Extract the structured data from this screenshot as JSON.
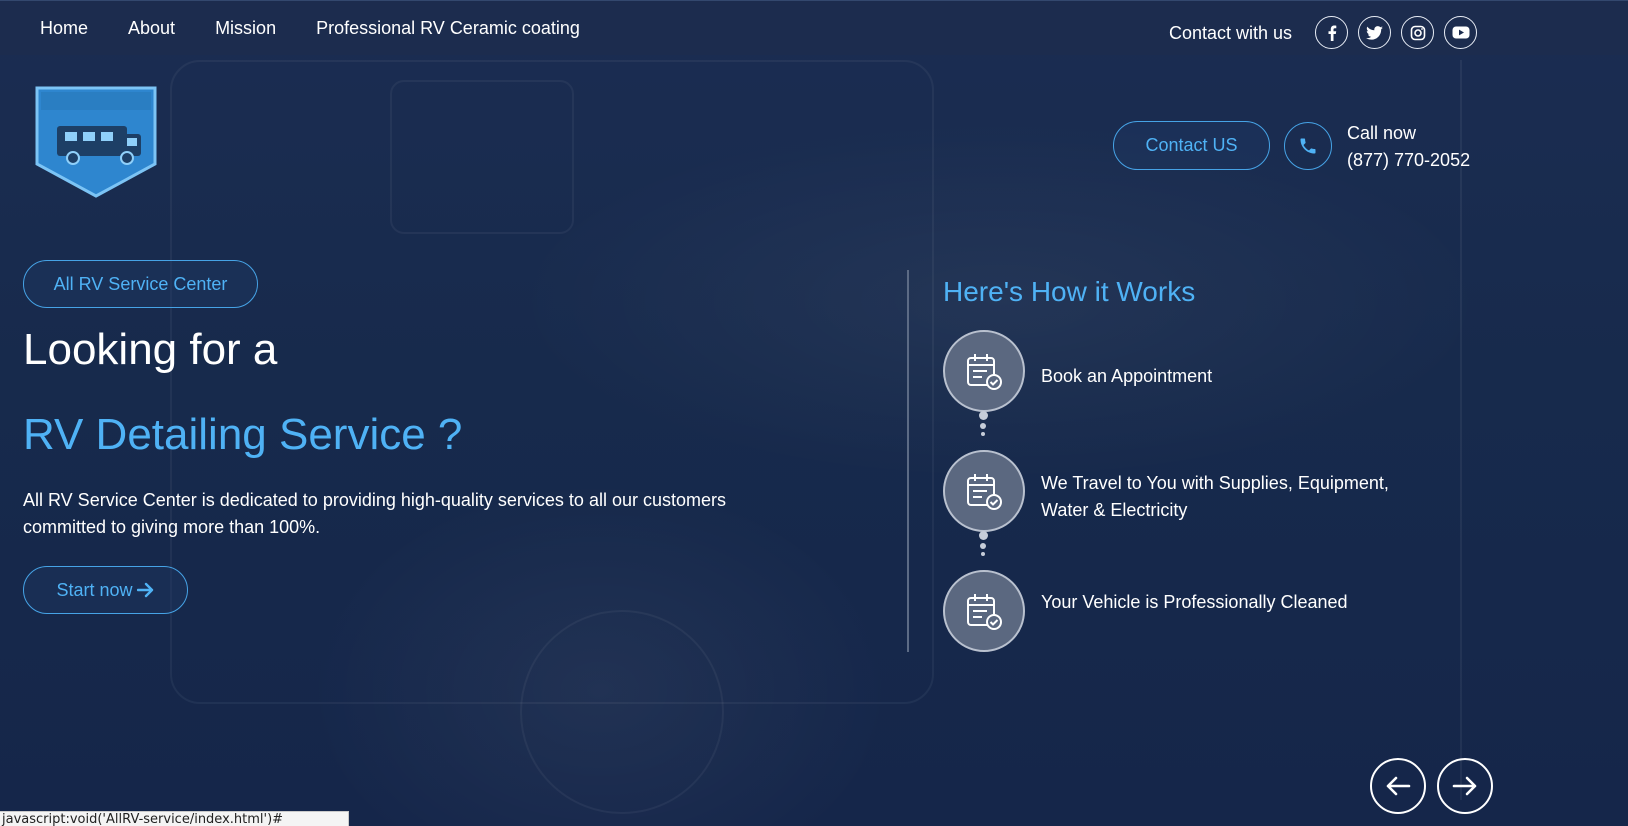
{
  "nav": {
    "items": [
      "Home",
      "About",
      "Mission",
      "Professional RV Ceramic coating"
    ]
  },
  "contact": {
    "label": "Contact with us",
    "socials": [
      "facebook-icon",
      "twitter-icon",
      "instagram-icon",
      "youtube-icon"
    ]
  },
  "logo": {
    "text": "ALL RV SERVICE CENTER"
  },
  "header_actions": {
    "contact_button": "Contact US",
    "call_label": "Call now",
    "phone": "(877) 770-2052"
  },
  "hero": {
    "tag": "All RV Service Center",
    "heading_line1": "Looking for a",
    "heading_line2": "RV Detailing Service ?",
    "description": "All RV Service Center is dedicated to providing high-quality services to all our customers committed to giving more than 100%.",
    "cta": "Start now"
  },
  "how_it_works": {
    "title": "Here's How it Works",
    "steps": [
      "Book an Appointment",
      "We Travel to You with Supplies, Equipment, Water & Electricity",
      "Your Vehicle is Professionally Cleaned"
    ]
  },
  "status_bar": {
    "url": "javascript:void('AllRV-service/index.html')#"
  },
  "colors": {
    "accent": "#4fb2f5",
    "background": "#16284a",
    "topbar": "#1c2c4e"
  }
}
